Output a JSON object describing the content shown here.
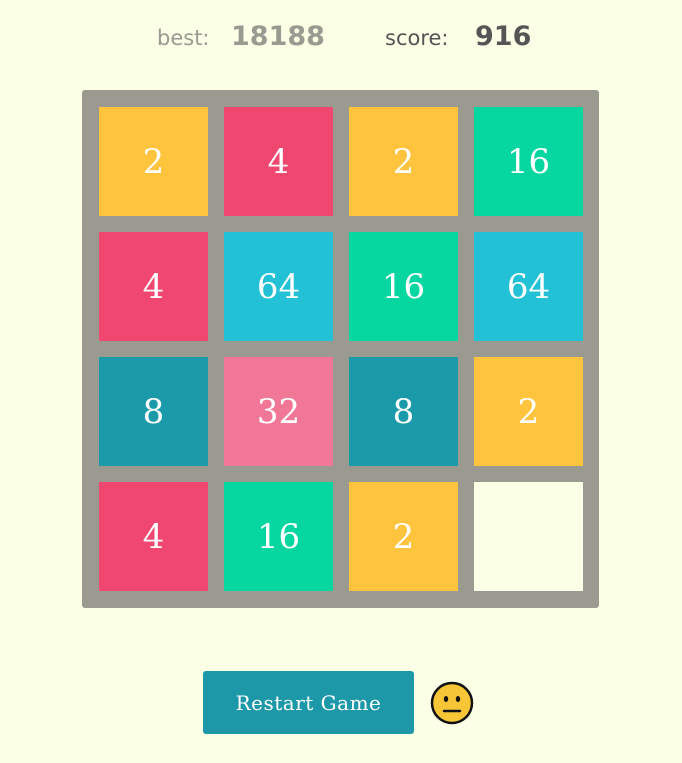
{
  "header": {
    "best_label": "best:",
    "best_value": "18188",
    "score_label": "score:",
    "score_value": "916"
  },
  "board": {
    "tiles": [
      [
        {
          "value": "2",
          "color": "#ffc43d"
        },
        {
          "value": "4",
          "color": "#ef476f"
        },
        {
          "value": "2",
          "color": "#ffc43d"
        },
        {
          "value": "16",
          "color": "#06d6a0"
        }
      ],
      [
        {
          "value": "4",
          "color": "#ef476f"
        },
        {
          "value": "64",
          "color": "#22c1d6"
        },
        {
          "value": "16",
          "color": "#06d6a0"
        },
        {
          "value": "64",
          "color": "#22c1d6"
        }
      ],
      [
        {
          "value": "8",
          "color": "#1b9aaa"
        },
        {
          "value": "32",
          "color": "#f17796"
        },
        {
          "value": "8",
          "color": "#1b9aaa"
        },
        {
          "value": "2",
          "color": "#ffc43d"
        }
      ],
      [
        {
          "value": "4",
          "color": "#ef476f"
        },
        {
          "value": "16",
          "color": "#06d6a0"
        },
        {
          "value": "2",
          "color": "#ffc43d"
        },
        {
          "value": "",
          "color": "#fbffe6"
        }
      ]
    ],
    "frame_color": "#9a9a90"
  },
  "controls": {
    "restart_label": "Restart Game",
    "status_icon": "neutral-face-icon"
  },
  "colors": {
    "background": "#fbffe6",
    "button": "#1d98a8",
    "face": "#f6c637"
  }
}
